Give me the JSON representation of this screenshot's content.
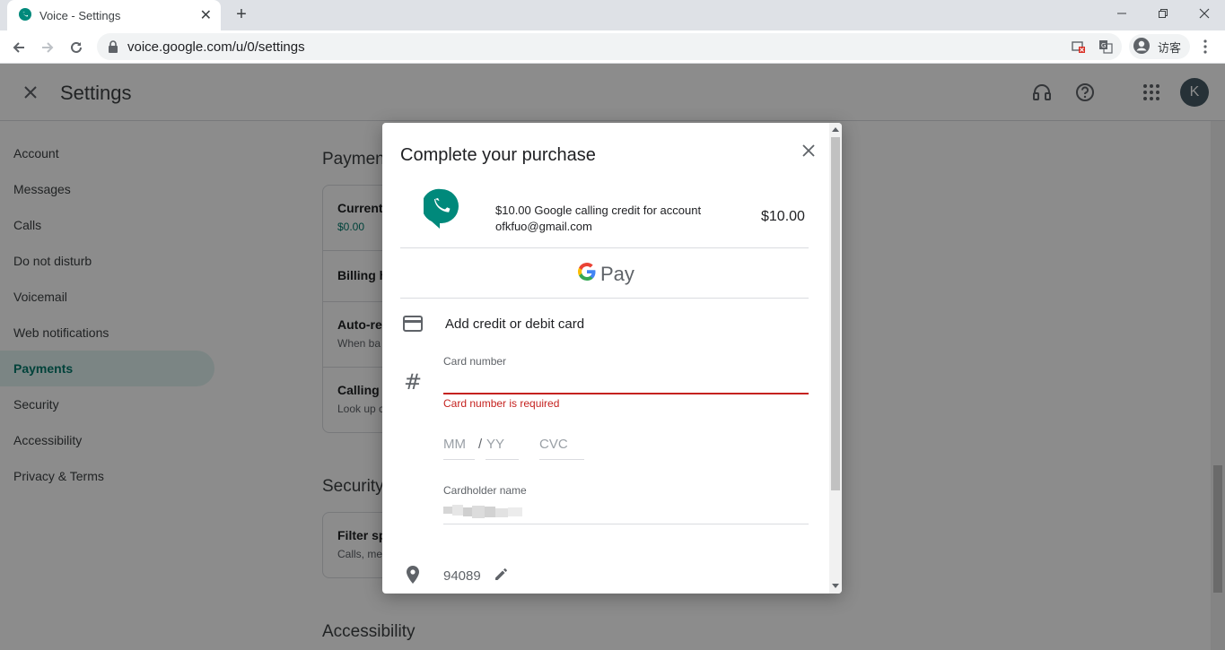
{
  "browser": {
    "tab_title": "Voice - Settings",
    "url": "voice.google.com/u/0/settings",
    "profile_label": "访客"
  },
  "app": {
    "title": "Settings",
    "avatar_letter": "K"
  },
  "sidebar": {
    "items": [
      {
        "label": "Account"
      },
      {
        "label": "Messages"
      },
      {
        "label": "Calls"
      },
      {
        "label": "Do not disturb"
      },
      {
        "label": "Voicemail"
      },
      {
        "label": "Web notifications"
      },
      {
        "label": "Payments",
        "active": true
      },
      {
        "label": "Security"
      },
      {
        "label": "Accessibility"
      },
      {
        "label": "Privacy & Terms"
      }
    ]
  },
  "content": {
    "payments_heading": "Payment",
    "current_credit_label": "Current",
    "current_credit_value": "$0.00",
    "billing_label": "Billing h",
    "autorecharge_label": "Auto-re",
    "autorecharge_sub": "When ba",
    "calling_label": "Calling",
    "calling_sub": "Look up c",
    "security_heading": "Security",
    "filter_label": "Filter sp",
    "filter_sub": "Calls, me",
    "accessibility_heading": "Accessibility"
  },
  "dialog": {
    "title": "Complete your purchase",
    "product_description": "$10.00 Google calling credit for account ofkfuo@gmail.com",
    "price": "$10.00",
    "gpay_label": "Pay",
    "add_card_label": "Add credit or debit card",
    "card_number_label": "Card number",
    "card_number_value": "",
    "card_number_error": "Card number is required",
    "month_placeholder": "MM",
    "slash": "/",
    "year_placeholder": "YY",
    "cvc_placeholder": "CVC",
    "cardholder_label": "Cardholder name",
    "zip": "94089"
  },
  "colors": {
    "brand_teal": "#00897b",
    "error_red": "#c5221f",
    "active_nav_bg": "#e0f2f1"
  }
}
